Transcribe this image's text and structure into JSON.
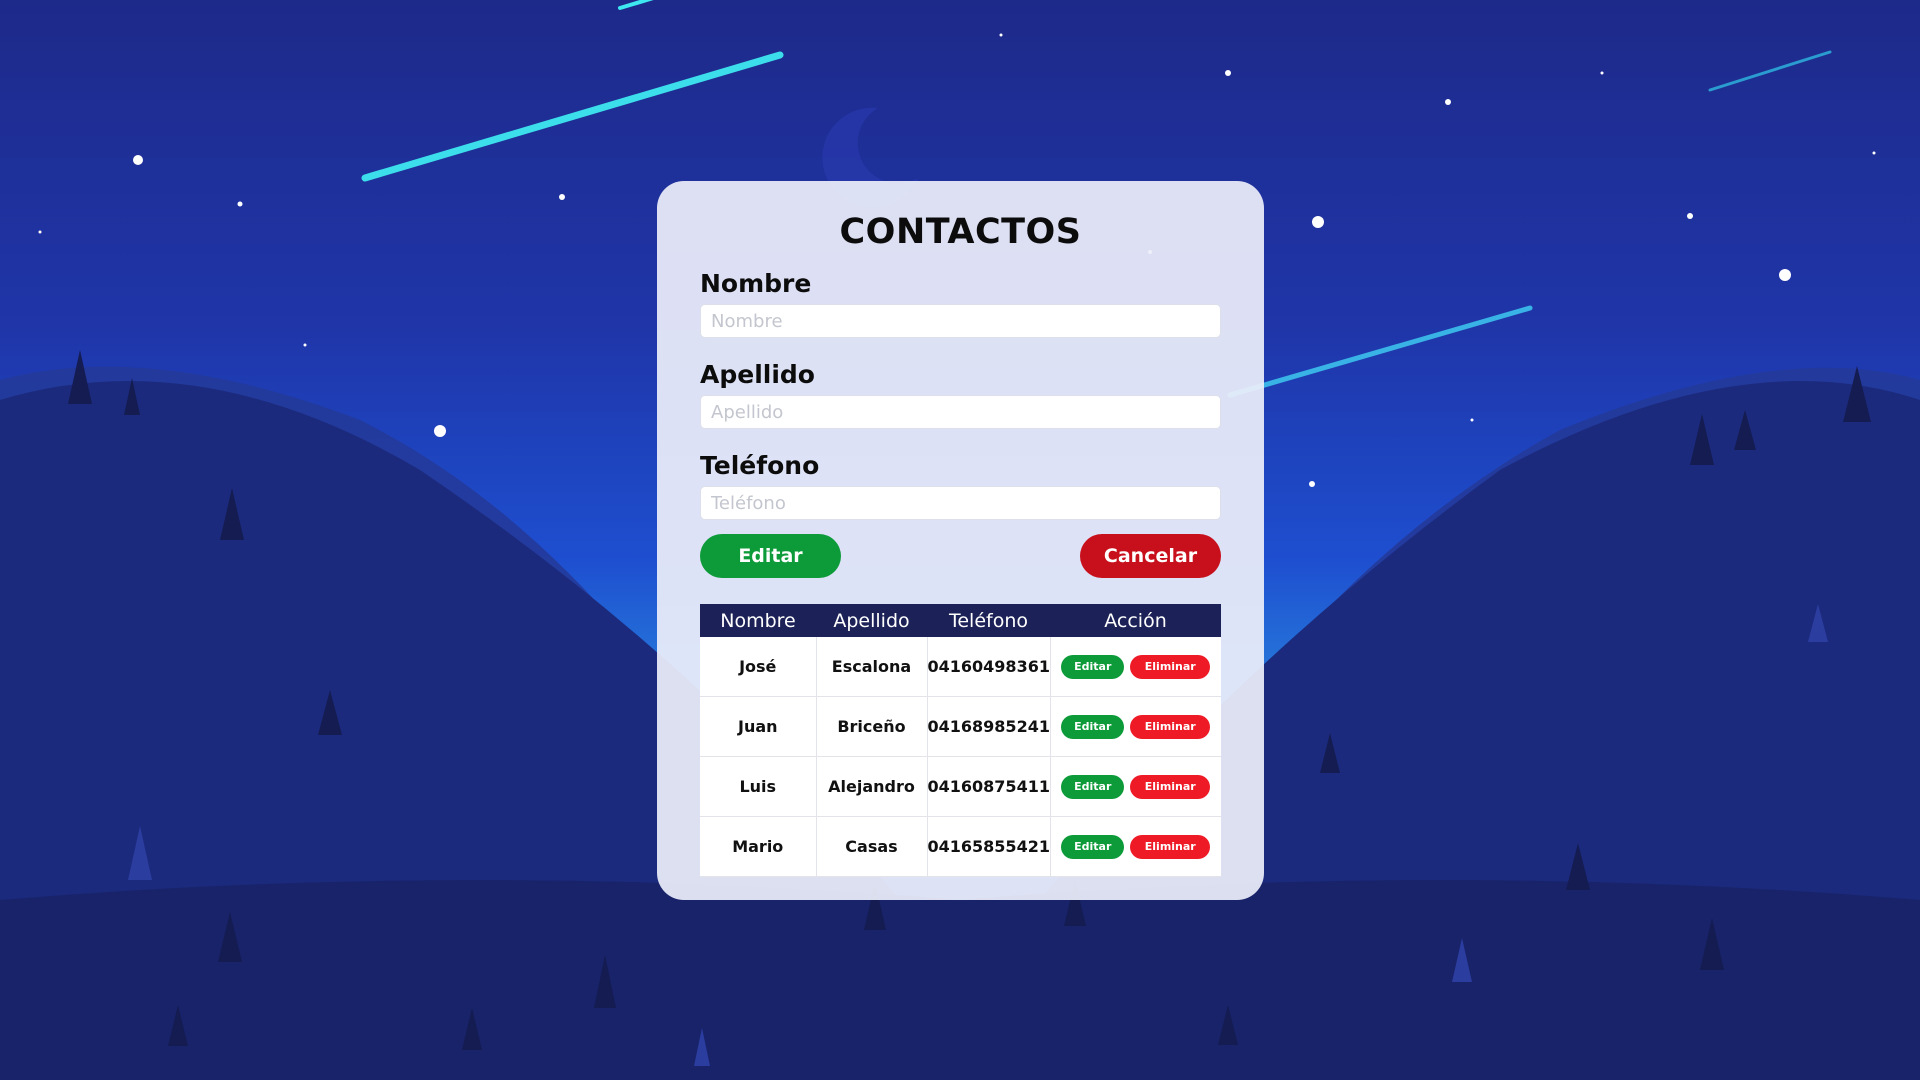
{
  "form": {
    "title": "CONTACTOS",
    "nombre_label": "Nombre",
    "nombre_placeholder": "Nombre",
    "nombre_value": "",
    "apellido_label": "Apellido",
    "apellido_placeholder": "Apellido",
    "apellido_value": "",
    "telefono_label": "Teléfono",
    "telefono_placeholder": "Teléfono",
    "telefono_value": "",
    "edit_button": "Editar",
    "cancel_button": "Cancelar"
  },
  "table": {
    "headers": [
      "Nombre",
      "Apellido",
      "Teléfono",
      "Acción"
    ],
    "rows": [
      {
        "nombre": "José",
        "apellido": "Escalona",
        "telefono": "04160498361"
      },
      {
        "nombre": "Juan",
        "apellido": "Briceño",
        "telefono": "04168985241"
      },
      {
        "nombre": "Luis",
        "apellido": "Alejandro",
        "telefono": "04160875411"
      },
      {
        "nombre": "Mario",
        "apellido": "Casas",
        "telefono": "04165855421"
      }
    ],
    "row_edit_label": "Editar",
    "row_delete_label": "Eliminar"
  },
  "colors": {
    "edit": "#0d9b3a",
    "cancel": "#c8101c",
    "delete": "#ee1b26",
    "table_header": "#1c2257"
  }
}
